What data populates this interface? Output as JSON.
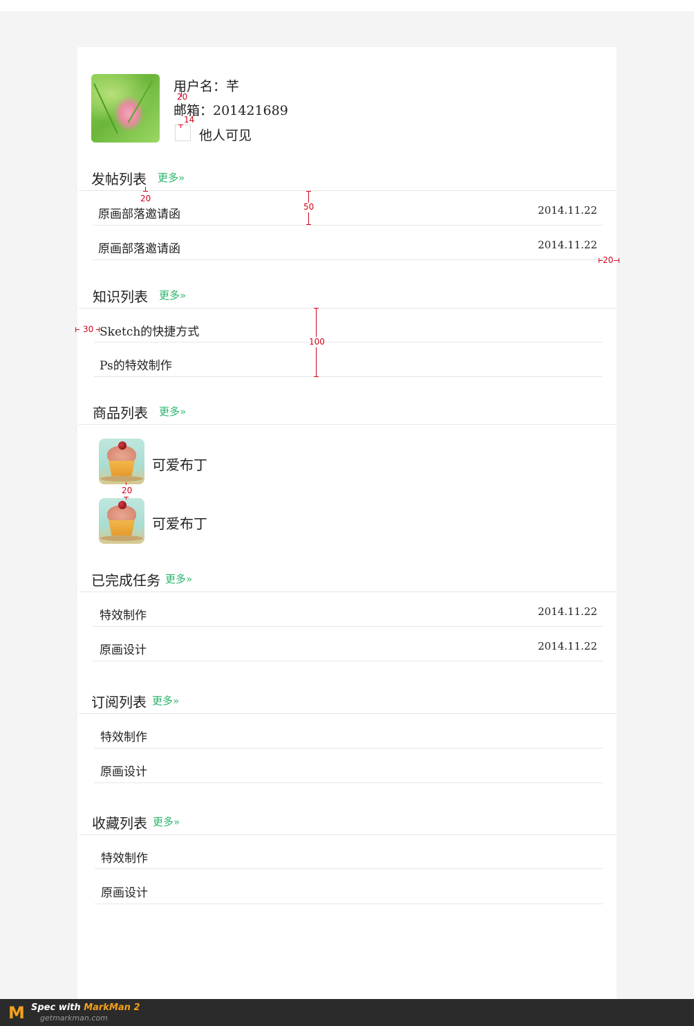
{
  "profile": {
    "username_line": "用户名：芊",
    "email_line": "邮箱：201421689",
    "visibility_label": "他人可见"
  },
  "more_label": "更多»",
  "posts": {
    "title": "发帖列表",
    "rows": [
      {
        "text": "原画部落邀请函",
        "date": "2014.11.22"
      },
      {
        "text": "原画部落邀请函",
        "date": "2014.11.22"
      }
    ]
  },
  "knowledge": {
    "title": "知识列表",
    "rows": [
      {
        "text": "Sketch的快捷方式"
      },
      {
        "text": "Ps的特效制作"
      }
    ]
  },
  "products": {
    "title": "商品列表",
    "items": [
      {
        "name": "可爱布丁",
        "icon": "cupcake-image"
      },
      {
        "name": "可爱布丁",
        "icon": "cupcake-image"
      }
    ]
  },
  "tasks": {
    "title": "已完成任务",
    "rows": [
      {
        "text": "特效制作",
        "date": "2014.11.22"
      },
      {
        "text": "原画设计",
        "date": "2014.11.22"
      }
    ]
  },
  "subscriptions": {
    "title": "订阅列表",
    "rows": [
      {
        "text": "特效制作"
      },
      {
        "text": "原画设计"
      }
    ]
  },
  "favorites": {
    "title": "收藏列表",
    "rows": [
      {
        "text": "特效制作"
      },
      {
        "text": "原画设计"
      }
    ]
  },
  "annotations": {
    "a20_top": "20",
    "a14": "14",
    "a20_title": "20",
    "a50": "50",
    "a20_right": "20",
    "a30": "30",
    "a100": "100",
    "a20_thumb": "20"
  },
  "footer": {
    "logo_letter": "M",
    "title_prefix": "Spec with ",
    "title_brand": "MarkMan 2",
    "url": "getmarkman.com"
  },
  "colors": {
    "accent_green": "#27b56a",
    "annotation_red": "#d0021b",
    "brand_orange": "#f4a21c"
  }
}
